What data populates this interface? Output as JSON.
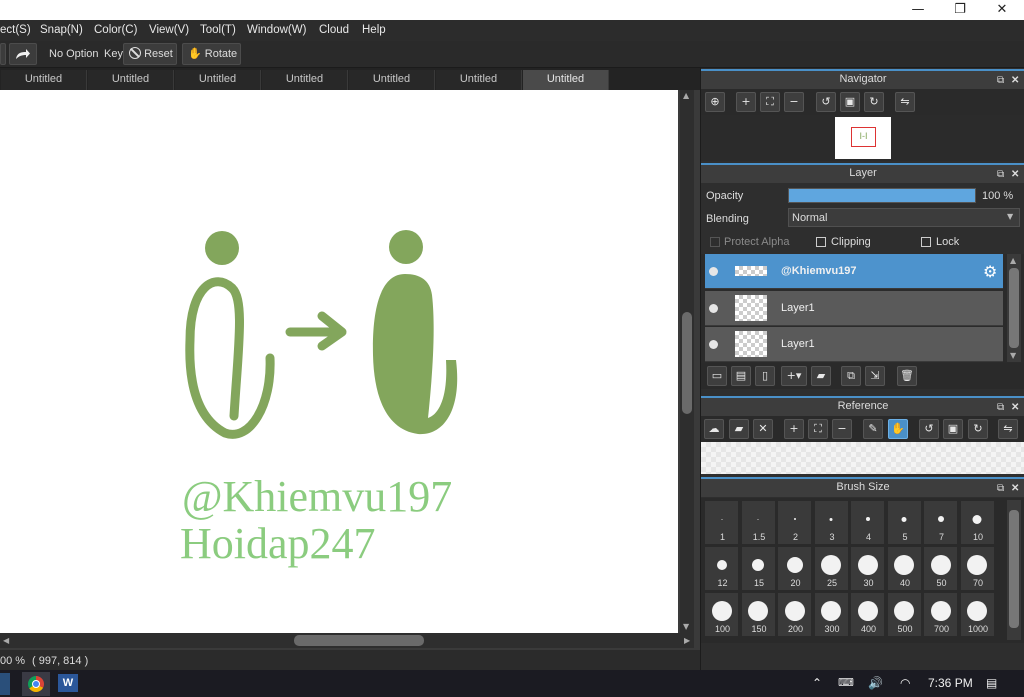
{
  "window": {
    "minimize_glyph": "—",
    "restore_glyph": "❐",
    "close_glyph": "✕"
  },
  "menu": [
    "ect(S)",
    "Snap(N)",
    "Color(C)",
    "View(V)",
    "Tool(T)",
    "Window(W)",
    "Cloud",
    "Help"
  ],
  "toolbar": {
    "option_label": "No Option",
    "key_label": "Key",
    "reset_label": "Reset",
    "rotate_label": "Rotate"
  },
  "tabs": [
    "Untitled",
    "Untitled",
    "Untitled",
    "Untitled",
    "Untitled",
    "Untitled",
    "Untitled"
  ],
  "canvas": {
    "watermark_line1": "@Khiemvu197",
    "watermark_line2": "Hoidap247",
    "art_color": "#83a65c",
    "watermark_color": "#8bcc7f"
  },
  "status": {
    "zoom_text": "00 %",
    "coords_text": "( 997, 814 )"
  },
  "navigator": {
    "title": "Navigator",
    "preview_text": "I-I"
  },
  "layer_panel": {
    "title": "Layer",
    "opacity_label": "Opacity",
    "opacity_value": "100 %",
    "opacity_fraction": 1.0,
    "blending_label": "Blending",
    "blending_value": "Normal",
    "protect_alpha_label": "Protect Alpha",
    "clipping_label": "Clipping",
    "lock_label": "Lock",
    "layers": [
      {
        "name": "@Khiemvu197",
        "selected": true
      },
      {
        "name": "Layer1",
        "selected": false
      },
      {
        "name": "Layer1",
        "selected": false
      }
    ]
  },
  "reference": {
    "title": "Reference"
  },
  "brush": {
    "title": "Brush Size",
    "sizes": [
      "1",
      "1.5",
      "2",
      "3",
      "4",
      "5",
      "7",
      "10",
      "12",
      "15",
      "20",
      "25",
      "30",
      "40",
      "50",
      "70",
      "100",
      "150",
      "200",
      "300",
      "400",
      "500",
      "700",
      "1000"
    ]
  },
  "taskbar": {
    "time": "7:36 PM",
    "word_label": "W"
  },
  "colors": {
    "accent": "#4a90c8",
    "selected_layer": "#4d93cd"
  }
}
